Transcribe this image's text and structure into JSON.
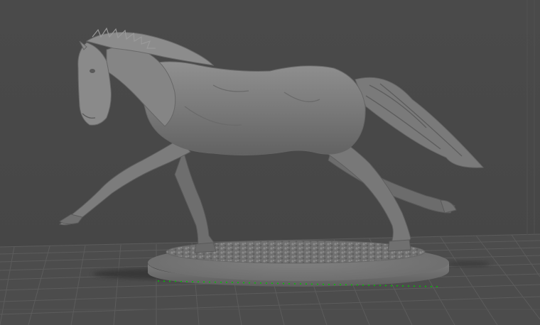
{
  "viewport": {
    "background_color": "#4a4a4a",
    "grid_color": "#5a5a5a",
    "grid_highlight_color": "#626262",
    "axis_indicator_color": "#00c400",
    "model_color": "#7c7c7c",
    "model_shadow_color": "#5c5c5c",
    "model_highlight_color": "#9a9a9a"
  },
  "scene": {
    "model_icon": "horse-sculpture",
    "base_icon": "oval-base-with-rubble-texture",
    "grid_icon": "build-plate-grid"
  }
}
